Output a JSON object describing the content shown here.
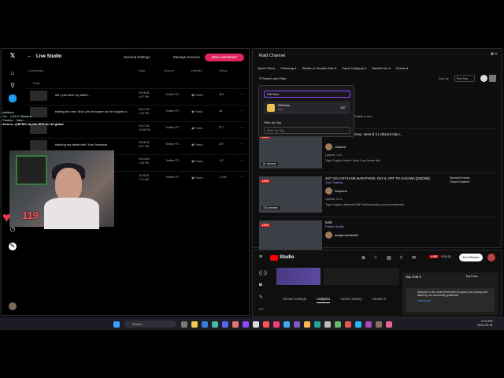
{
  "x_panel": {
    "header_title": "Live Studio",
    "general_settings": "General Settings",
    "manage_sources": "Manage Sources",
    "new_livestream": "New Livestream",
    "columns": [
      "Livestream",
      "Date",
      "Source",
      "Visibility",
      "Views"
    ],
    "past_label": "Past",
    "rows": [
      {
        "title": "did i just brick my tablet...",
        "date": "09/18/26",
        "time": "4:57 PM",
        "source": "Twitter RT...",
        "visibility": "Public",
        "views": "431"
      },
      {
        "title": "testing the new 'Wvs' pfs formware on the longest o...",
        "date": "09/17/26",
        "time": "1:25 PM",
        "source": "Twitter RT...",
        "visibility": "Public",
        "views": "46"
      },
      {
        "title": "",
        "date": "09/17/26",
        "time": "12:46 PM",
        "source": "Twitter RT...",
        "visibility": "Public",
        "views": "577"
      },
      {
        "title": "flashing my tablet with 'Wvs' firmware",
        "date": "09/16/26",
        "time": "3:57 PM",
        "source": "Twitter RT...",
        "visibility": "Public",
        "views": "287"
      },
      {
        "title": "",
        "date": "09/14/26",
        "time": "1:38 PM",
        "source": "Twitter RT...",
        "visibility": "Public",
        "views": "147"
      },
      {
        "title": "",
        "date": "11/05/25",
        "time": "1:21 AM",
        "source": "Twitter RT...",
        "visibility": "Public",
        "views": "1,248"
      }
    ]
  },
  "overlay": {
    "chat_lines": [
      "...(strikes)",
      "...Ca... 1.84 X Viewers",
      "...Trashin... Nerb...",
      "...Kssrrn: @BTMC do the RPS for 50 gifted"
    ],
    "heart_count": "119"
  },
  "twitch": {
    "title": "Raid Channel",
    "quick_filters_label": "Quick Filters",
    "quick_filters": [
      "Following ▾",
      "Similar or Smaller Size ▾",
      "Same Category ▾",
      "Raided You ▾",
      "Events ▾"
    ],
    "search_filter": "Search and Filter",
    "sort_by_label": "Sort by",
    "sort_value": "For You",
    "dropdown": {
      "search_value": "RAFishu",
      "item_name": "RAFishu",
      "item_sub": "osu!",
      "item_count": "267",
      "filter_tag_label": "Filter by Tag",
      "filter_tag_placeholder": "Filter by Tag"
    },
    "cards": [
      {
        "title": "...ide supporter",
        "channel": "",
        "user": "",
        "uptime": "",
        "tags": "Tags: Polski  Português  English  ai  vers",
        "viewers": "",
        "events": ""
      },
      {
        "title": "... supporter w/ @pezcrg - Best of 3 | !discord !clip !...",
        "channel": "",
        "user": "Unaired",
        "uptime": "Uptime: 1:42",
        "tags": "Tags: English  Vtuber  Comfy  Cozy  Anime  silly",
        "viewers": "84 viewers",
        "events": ""
      },
      {
        "title": "24/7 GO CATCH EM MARATHON, DAY 6, OFF TO KAGAWA [263/365]",
        "channel": "Just Chatting",
        "user": "Deqscriu",
        "uptime": "Uptime: 0:31",
        "tags": "Tags: English  LifestreamSMP  NoBackseating  meow  monsterdad",
        "viewers": "100 viewers",
        "events": "Special Events:\nDrops Enabled"
      },
      {
        "title": "hello",
        "channel": "Roblox Studio",
        "user": "dergnmcesteb83",
        "uptime": "",
        "tags": "",
        "viewers": "",
        "events": ""
      }
    ]
  },
  "youtube": {
    "brand": "Studio",
    "live_badge": "LIVE",
    "timer": "0:20:34",
    "end_stream": "End Stream",
    "tabs": [
      "Stream settings",
      "Analytics",
      "Viewer activity",
      "Stream h"
    ],
    "active_tab": "Analytics",
    "chat_title": "Top chat ▾",
    "top_fans": "Top Fans",
    "welcome": "Welcome to live chat! Remember to guard your privacy and abide by our community guidelines.",
    "learn_more": "Learn more"
  },
  "taskbar": {
    "search": "Search",
    "time": "6:23 PM",
    "date": "2026-09-18"
  }
}
